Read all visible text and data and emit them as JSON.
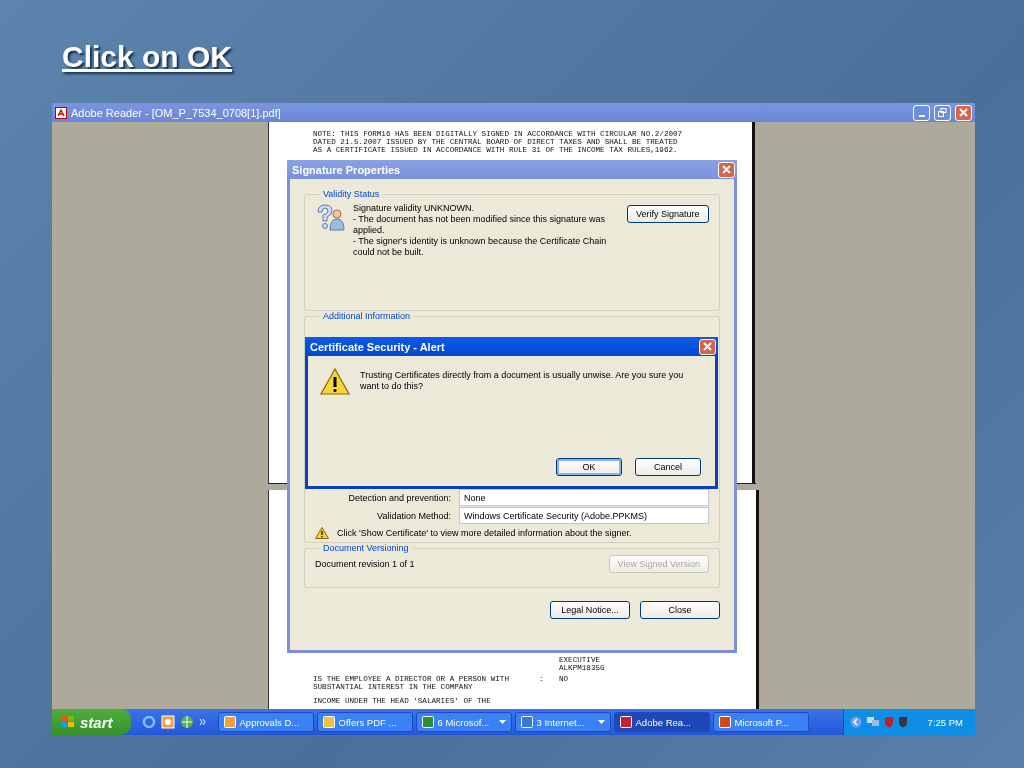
{
  "slide": {
    "title": "Click on OK"
  },
  "window": {
    "title": "Adobe Reader - [OM_P_7534_0708[1].pdf]"
  },
  "document": {
    "page_1_lines": [
      "NOTE: THIS FORM16 HAS BEEN DIGITALLY SIGNED IN ACCORDANCE WITH CIRCULAR NO.2/2007",
      "DATED 21.5.2007 ISSUED BY THE CENTRAL BOARD OF DIRECT TAXES AND SHALL BE TREATED",
      "AS A CERTIFICATE ISSUED IN ACCORDANCE WITH RULE 31 OF THE INCOME TAX RULES,1962."
    ],
    "page_2_values": [
      "EXECUTIVE",
      "ALKPM1835G"
    ],
    "page_2_rows": [
      {
        "label": "IS THE EMPLOYEE A DIRECTOR OR A PERSON WITH",
        "separator": ":",
        "value": "NO"
      },
      {
        "label": "SUBSTANTIAL INTEREST IN THE COMPANY"
      },
      {
        "label": "INCOME UNDER THE HEAD 'SALARIES' OF THE"
      }
    ]
  },
  "signature_dialog": {
    "title": "Signature Properties",
    "validity_status": {
      "legend": "Validity Status",
      "lines": [
        "Signature validity UNKNOWN.",
        "- The document has not been modified since this signature was applied.",
        "- The signer's identity is unknown because the Certificate Chain could not be built."
      ],
      "button": "Verify Signature"
    },
    "additional_information": {
      "legend": "Additional Information",
      "fields": [
        {
          "label": "Detection and prevention:",
          "value": "None"
        },
        {
          "label": "Validation Method:",
          "value": "Windows Certificate Security (Adobe.PPKMS)"
        }
      ],
      "warning": "Click 'Show Certificate' to view more detailed information about the signer."
    },
    "document_versioning": {
      "legend": "Document Versioning",
      "revision": "Document revision 1 of 1",
      "button": {
        "label": "View Signed Version",
        "disabled": true
      }
    },
    "buttons": [
      "Legal Notice...",
      "Close"
    ]
  },
  "alert": {
    "title": "Certificate Security - Alert",
    "message": "Trusting Certificates directly from a document is usually unwise. Are you sure you want to do this?",
    "buttons": [
      {
        "label": "OK",
        "default": true
      },
      {
        "label": "Cancel",
        "default": false
      }
    ]
  },
  "taskbar": {
    "start": "start",
    "tasks": [
      {
        "label": "Approvals D...",
        "active": false,
        "grouped": false
      },
      {
        "label": "Offers PDF ...",
        "active": false,
        "grouped": false
      },
      {
        "label": "6 Microsof...",
        "active": false,
        "grouped": true
      },
      {
        "label": "3 Internet...",
        "active": false,
        "grouped": true
      },
      {
        "label": "Adobe Rea...",
        "active": true,
        "grouped": false
      },
      {
        "label": "Microsoft P...",
        "active": false,
        "grouped": false
      }
    ],
    "clock": "7:25 PM"
  }
}
